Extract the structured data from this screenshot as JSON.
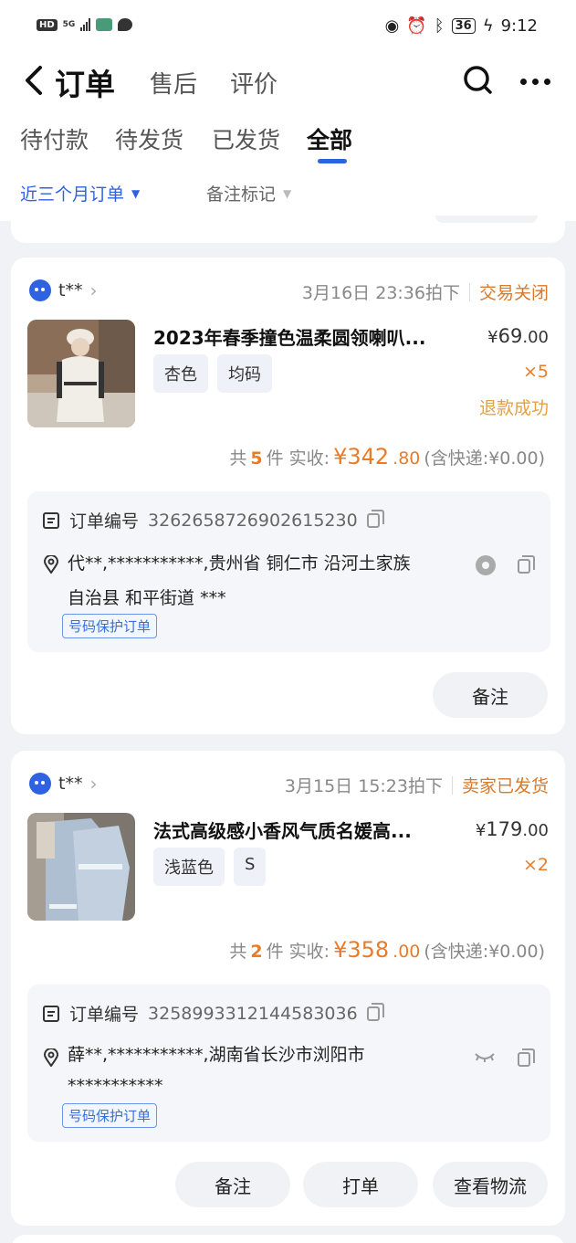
{
  "status_bar": {
    "hd": "HD",
    "network": "5G",
    "battery": "36",
    "time": "9:12"
  },
  "nav": {
    "title": "订单",
    "tabs": [
      "售后",
      "评价"
    ]
  },
  "order_tabs": [
    "待付款",
    "待发货",
    "已发货",
    "全部"
  ],
  "active_tab": "全部",
  "filters": {
    "range": "近三个月订单",
    "remark_flag": "备注标记"
  },
  "orders": [
    {
      "shop": "t**",
      "time": "3月16日 23:36拍下",
      "status": "交易关闭",
      "title": "2023年春季撞色温柔圆领喇叭...",
      "options": [
        "杏色",
        "均码"
      ],
      "currency": "¥",
      "price_int": "69",
      "price_dec": ".00",
      "qty": "×5",
      "refund": "退款成功",
      "count_prefix": "共",
      "count": "5",
      "count_suffix": "件  实收:",
      "amount_int": "¥342",
      "amount_dec": ".80",
      "shipping": "(含快递:¥0.00)",
      "order_no_label": "订单编号",
      "order_no": "3262658726902615230",
      "address_line1": "代**,***********,贵州省 铜仁市 沿河土家族",
      "address_line2": "自治县 和平街道 ***",
      "protect_tag": "号码保护订单",
      "buttons": [
        "备注"
      ]
    },
    {
      "shop": "t**",
      "time": "3月15日 15:23拍下",
      "status": "卖家已发货",
      "title": "法式高级感小香风气质名媛高...",
      "options": [
        "浅蓝色",
        "S"
      ],
      "currency": "¥",
      "price_int": "179",
      "price_dec": ".00",
      "qty": "×2",
      "count_prefix": "共",
      "count": "2",
      "count_suffix": "件  实收:",
      "amount_int": "¥358",
      "amount_dec": ".00",
      "shipping": "(含快递:¥0.00)",
      "order_no_label": "订单编号",
      "order_no": "3258993312144583036",
      "address_line1": "薛**,***********,湖南省长沙市浏阳市",
      "address_line2": "***********",
      "protect_tag": "号码保护订单",
      "buttons": [
        "备注",
        "打单",
        "查看物流"
      ]
    }
  ],
  "colors": {
    "accent": "#2f62e0",
    "status_orange": "#d9792a",
    "refund_text": "#e3a046",
    "amount": "#e87c2a"
  }
}
